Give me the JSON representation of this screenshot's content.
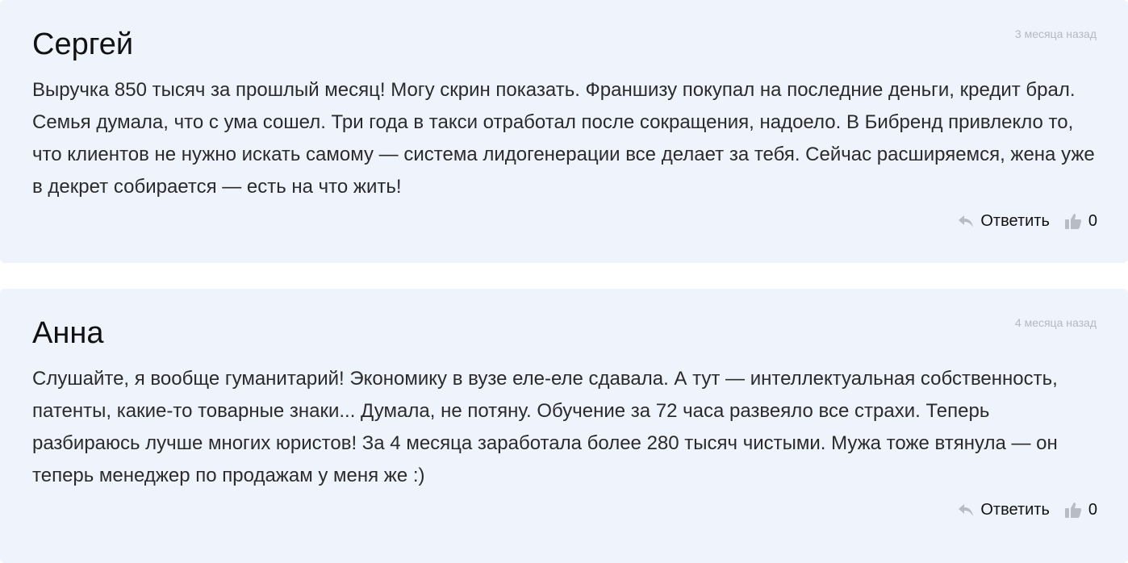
{
  "comments": [
    {
      "author": "Сергей",
      "date": "3 месяца назад",
      "text": "Выручка 850 тысяч за прошлый месяц! Могу скрин показать. Франшизу покупал на последние деньги, кредит брал. Семья думала, что с ума сошел. Три года в такси отработал после сокращения, надоело. В Бибренд привлекло то, что клиентов не нужно искать самому — система лидогенерации все делает за тебя. Сейчас расширяемся, жена уже в декрет собирается — есть на что жить!",
      "reply_label": "Ответить",
      "likes": "0"
    },
    {
      "author": "Анна",
      "date": "4 месяца назад",
      "text": "Слушайте, я вообще гуманитарий! Экономику в вузе еле-еле сдавала. А тут — интеллектуальная собственность, патенты, какие-то товарные знаки... Думала, не потяну. Обучение за 72 часа развеяло все страхи. Теперь разбираюсь лучше многих юристов! За 4 месяца заработала более 280 тысяч чистыми. Мужа тоже втянула — он теперь менеджер по продажам у меня же :)",
      "reply_label": "Ответить",
      "likes": "0"
    }
  ],
  "icons": {
    "reply": "reply-arrow-icon",
    "like": "thumbs-up-icon",
    "icon_color": "#b8bcc4"
  }
}
